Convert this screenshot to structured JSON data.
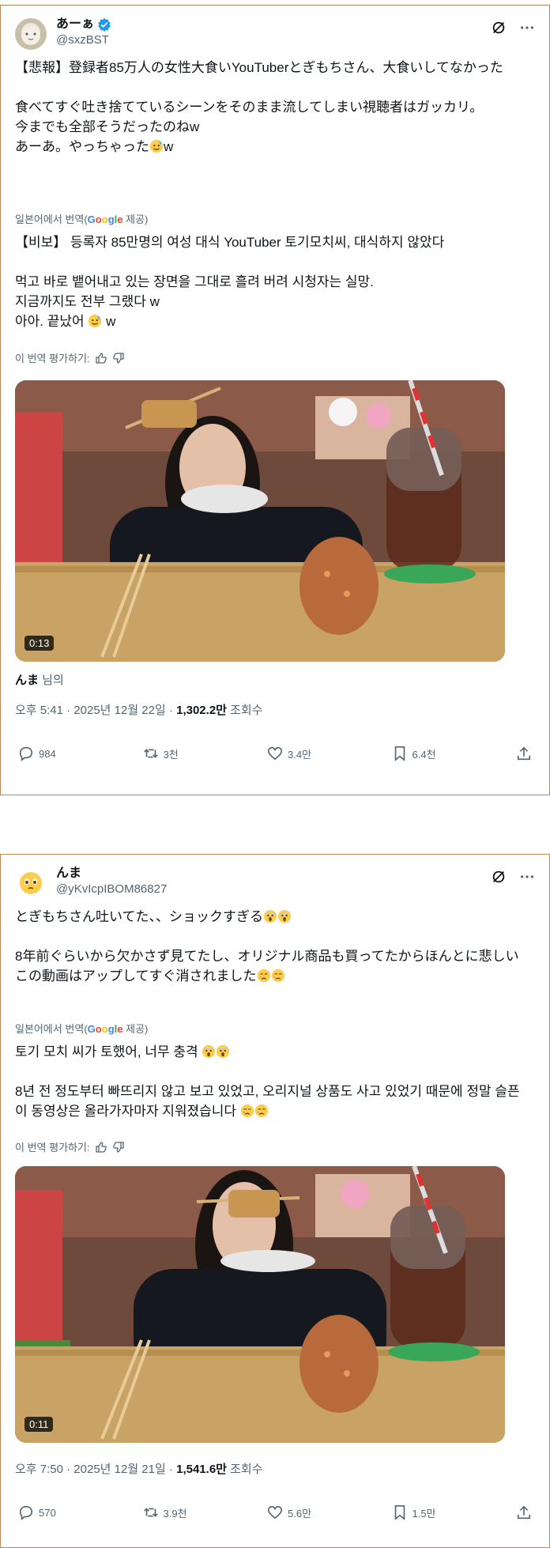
{
  "tweet1": {
    "display_name": "あーぁ",
    "handle": "@sxzBST",
    "text_ja": "【悲報】登録者85万人の女性大食いYouTuberとぎもちさん、大食いしてなかった\n\n食べてすぐ吐き捨てているシーンをそのまま流してしまい視聴者はガッカリ。\n今までも全部そうだったのねw\nあーあ。やっちゃった",
    "text_ja_end": "w",
    "translated_by": "일본어에서 번역(",
    "google": "Google",
    "translated_tail": " 제공)",
    "text_ko": "【비보】 등록자 85만명의 여성 대식 YouTuber 토기모치씨, 대식하지 않았다\n\n먹고 바로 뱉어내고 있는 장면을 그대로 흘려 버려 시청자는 실망.\n지금까지도 전부 그랬다 w\n아아. 끝났어",
    "text_ko_end": " w",
    "rate_label": "이 번역 평가하기:",
    "duration": "0:13",
    "ref_name": "んま",
    "ref_suffix": " 님의",
    "time": "오후 5:41 · 2025년 12월 22일 · ",
    "views": "1,302.2만",
    "views_label": " 조회수",
    "replies": "984",
    "reposts": "3천",
    "likes": "3.4만",
    "bookmarks": "6.4천"
  },
  "tweet2": {
    "display_name": "んま",
    "handle": "@yKvIcpIBOM86827",
    "line1": "とぎもちさん吐いてた、、ショックすぎる",
    "line2": "8年前ぐらいから欠かさず見てたし、オリジナル商品も買ってたからほんとに悲しい",
    "line3": "この動画はアップしてすぐ消されました",
    "translated_by": "일본어에서 번역(",
    "google": "Google",
    "translated_tail": " 제공)",
    "ko1": "토기 모치 씨가 토했어, 너무 충격",
    "ko2": "8년 전 정도부터 빠뜨리지 않고 보고 있었고, 오리지널 상품도 사고 있었기 때문에 정말 슬픈 이 동영상은 올라가자마자 지워졌습니다",
    "rate_label": "이 번역 평가하기:",
    "duration": "0:11",
    "time": "오후 7:50 · 2025년 12월 21일 · ",
    "views": "1,541.6만",
    "views_label": " 조회수",
    "replies": "570",
    "reposts": "3.9천",
    "likes": "5.6만",
    "bookmarks": "1.5만"
  },
  "colors": {
    "accent": "#1d9bf0",
    "secondary_text": "#536471",
    "border": "#b8875a"
  }
}
